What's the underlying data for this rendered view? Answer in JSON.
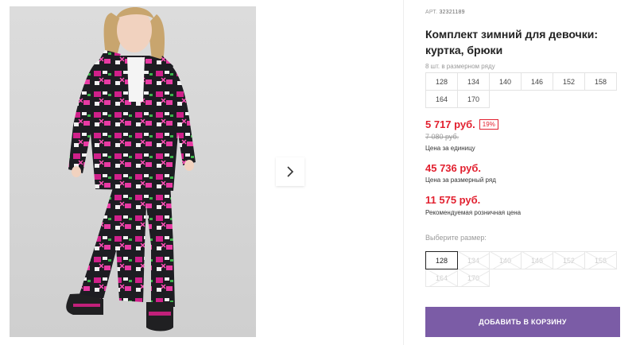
{
  "product": {
    "sku_label": "АРТ.",
    "sku_code": "32321189",
    "title": "Комплект зимний для девочки: куртка, брюки",
    "image_alt": "Девочка в зимнем комплекте с ярким принтом"
  },
  "gallery": {
    "next_icon": "chevron-right-icon"
  },
  "size_range": {
    "note": "8 шт. в размерном ряду",
    "sizes": [
      "128",
      "134",
      "140",
      "146",
      "152",
      "158",
      "164",
      "170"
    ]
  },
  "pricing": {
    "unit_price": "5 717 руб.",
    "discount": "19%",
    "old_price": "7 080 руб.",
    "unit_price_note": "Цена за единицу",
    "range_price": "45 736 руб.",
    "range_price_note": "Цена за размерный ряд",
    "rrp": "11 575 руб.",
    "rrp_note": "Рекомендуемая розничная цена"
  },
  "size_select": {
    "label": "Выберите размер:",
    "selected": "128",
    "options": [
      "128",
      "134",
      "140",
      "146",
      "152",
      "158",
      "164",
      "170"
    ]
  },
  "cart": {
    "add_label": "ДОБАВИТЬ В КОРЗИНУ"
  },
  "colors": {
    "accent": "#e2202f",
    "button": "#7b5ca6"
  }
}
